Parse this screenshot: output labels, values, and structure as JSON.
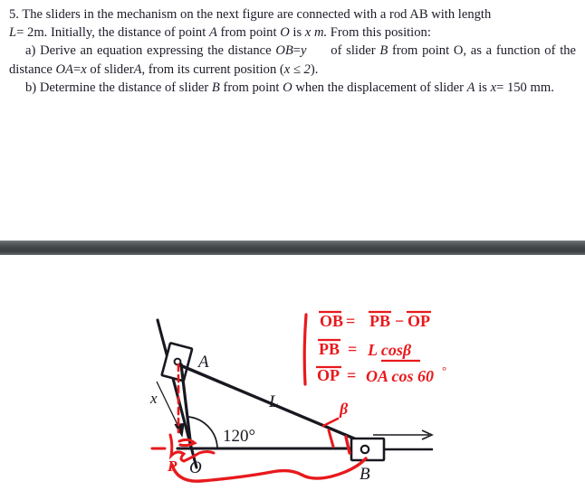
{
  "document": {
    "problem_number": "5.",
    "line1": "The sliders in the mechanism on the next figure are connected with a rod AB with length",
    "line2_pre": "L",
    "line2_eq": "= 2",
    "line2_unit": "m.",
    "line2_rest": "Initially, the distance of point",
    "line2_A": "A",
    "line2_from": "from point",
    "line2_O": "O",
    "line2_is": "is",
    "line2_x": "x",
    "line2_m": "m.",
    "line2_tail": "From this position:",
    "part_a_label": "a)",
    "part_a_text1": "Derive an equation expressing the distance",
    "part_a_ob": "OB",
    "part_a_eq": "=",
    "part_a_y": "y",
    "part_a_text2": "of slider",
    "part_a_B": "B",
    "part_a_text3": "from point O, as a",
    "part_a_text4": "function of the distance",
    "part_a_oa": "OA",
    "part_a_eq2": "=",
    "part_a_x": "x",
    "part_a_text5": "of slider",
    "part_a_A": "A",
    "part_a_text6": ", from its current position (",
    "part_a_cond": "x ≤ 2",
    "part_a_text7": ").",
    "part_b_label": "b)",
    "part_b_text1": "Determine the distance of slider",
    "part_b_B": "B",
    "part_b_text2": "from point",
    "part_b_O": "O",
    "part_b_text3": "when the displacement of slider",
    "part_b_A": "A",
    "part_b_text4": "is",
    "part_b_x": "x",
    "part_b_eq": "= 150",
    "part_b_unit": "mm."
  },
  "figure": {
    "labels": {
      "point_a": "A",
      "point_o": "O",
      "point_b": "B",
      "rod_length": "L",
      "displacement_x": "x",
      "angle": "120°"
    },
    "handwriting": {
      "eq1_lhs": "OB",
      "eq1_mid": "=",
      "eq1_rhs_a": "PB",
      "eq1_minus": "−",
      "eq1_rhs_b": "OP",
      "eq2_lhs": "PB",
      "eq2_mid": "=",
      "eq2_rhs": "L cosβ",
      "eq3_lhs": "OP",
      "eq3_mid": "=",
      "eq3_rhs": "OA cos 60",
      "eq3_deg": "°",
      "beta_at_b": "β",
      "point_p": "P"
    }
  },
  "colors": {
    "text": "#1b1b28",
    "ink_red": "#e8191c",
    "figure_black": "#181820",
    "separator_dark": "#3b3f42"
  }
}
